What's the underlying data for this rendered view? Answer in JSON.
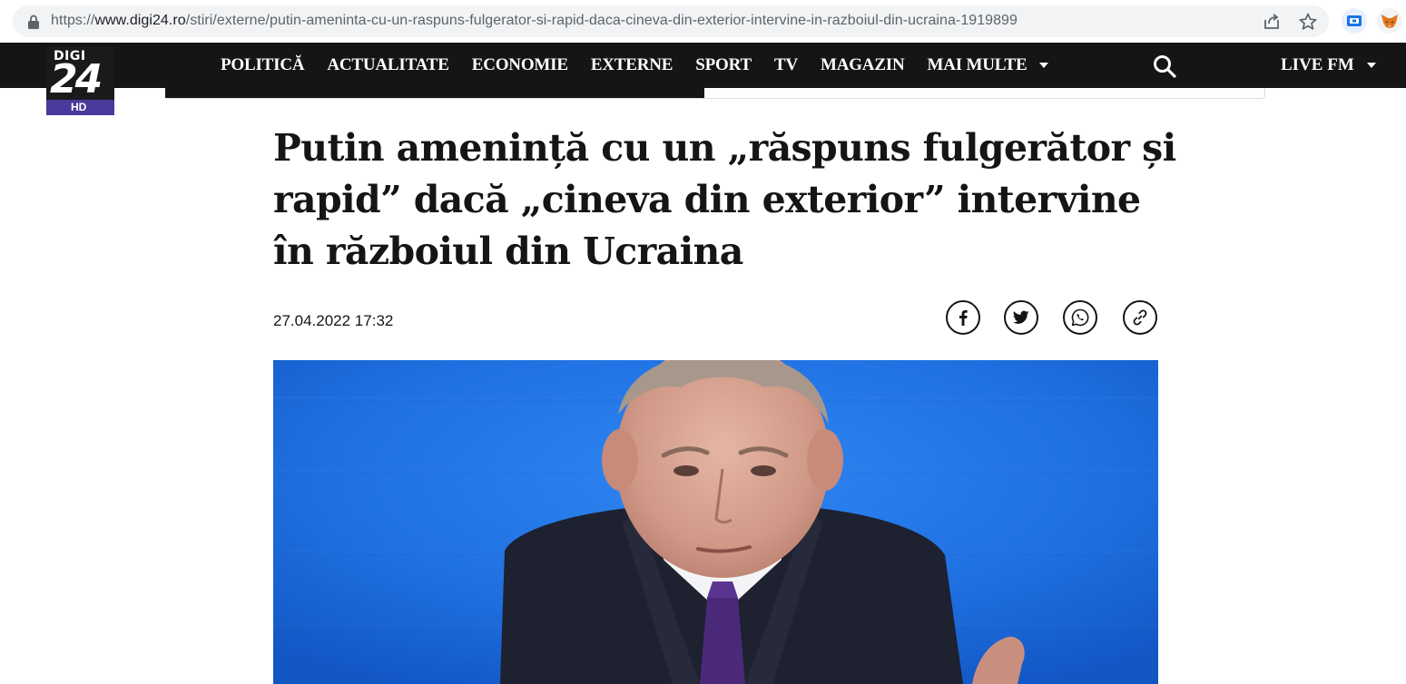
{
  "browser": {
    "url_scheme": "https://",
    "url_host": "www.digi24.ro",
    "url_path": "/stiri/externe/putin-ameninta-cu-un-raspuns-fulgerator-si-rapid-daca-cineva-din-exterior-intervine-in-razboiul-din-ucraina-1919899",
    "icons": [
      "lock-icon",
      "share-page-icon",
      "bookmark-star-icon",
      "extension-icon",
      "metamask-fox-icon"
    ]
  },
  "site": {
    "logo": {
      "top": "DIGI",
      "number": "24",
      "badge": "HD"
    },
    "nav": [
      {
        "label": "POLITICĂ"
      },
      {
        "label": "ACTUALITATE"
      },
      {
        "label": "ECONOMIE"
      },
      {
        "label": "EXTERNE"
      },
      {
        "label": "SPORT"
      },
      {
        "label": "TV"
      },
      {
        "label": "MAGAZIN"
      },
      {
        "label": "MAI MULTE"
      }
    ],
    "live": "LIVE FM",
    "colors": {
      "nav_bg": "#151515",
      "logo_accent": "#4a3a9c",
      "hero_bg": "#1f6fe0"
    }
  },
  "reading_progress": 0.49,
  "article": {
    "title": "Putin amenință cu un „răspuns fulgerător și rapid” dacă „cineva din exterior” intervine în războiul din Ucraina",
    "datetime": "27.04.2022 17:32",
    "share": [
      "facebook-icon",
      "twitter-icon",
      "whatsapp-icon",
      "copy-link-icon"
    ]
  }
}
